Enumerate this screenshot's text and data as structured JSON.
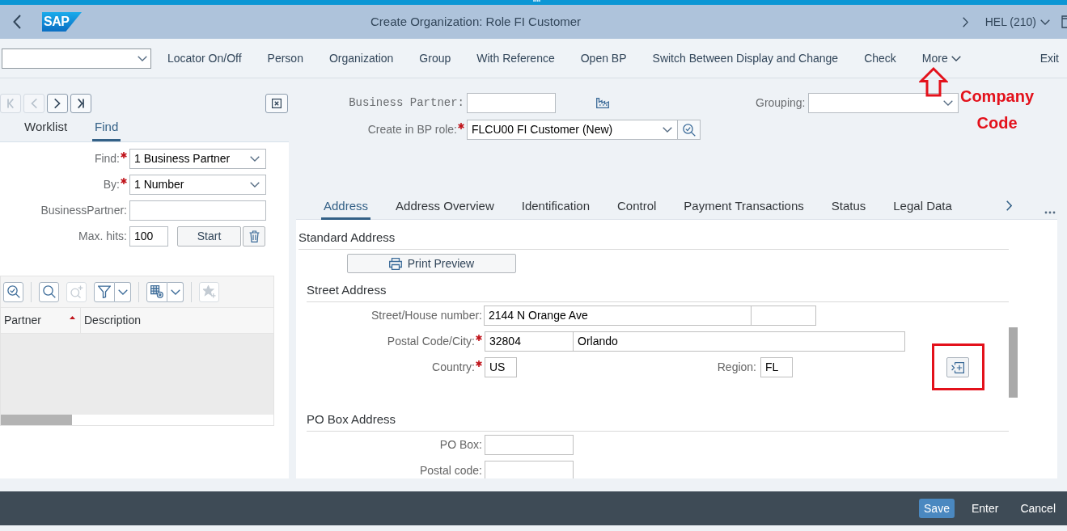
{
  "shell": {
    "logo": "SAP",
    "title": "Create Organization: Role FI Customer",
    "system": "HEL (210)"
  },
  "toolbar": {
    "items": [
      {
        "label": "Locator On/Off",
        "kind": "button"
      },
      {
        "label": "Person",
        "kind": "button"
      },
      {
        "label": "Organization",
        "kind": "button"
      },
      {
        "label": "Group",
        "kind": "button"
      },
      {
        "label": "With Reference",
        "kind": "button"
      },
      {
        "label": "Open BP",
        "kind": "button"
      },
      {
        "label": "Switch Between Display and Change",
        "kind": "button"
      },
      {
        "label": "Check",
        "kind": "button"
      },
      {
        "label": "More",
        "kind": "menu"
      }
    ],
    "exit": "Exit"
  },
  "side_panel": {
    "nav_buttons": [
      {
        "disabled": true
      },
      {
        "disabled": true
      },
      {
        "disabled": false
      },
      {
        "disabled": false
      }
    ],
    "tabs": [
      {
        "label": "Worklist",
        "selected": false
      },
      {
        "label": "Find",
        "selected": true
      }
    ],
    "form": [
      {
        "label": "Find:",
        "required": true,
        "kind": "select",
        "value": "1 Business Partner"
      },
      {
        "label": "By:",
        "required": true,
        "kind": "select",
        "value": "1 Number"
      },
      {
        "label": "BusinessPartner:",
        "required": false,
        "kind": "input"
      },
      {
        "label": "Max. hits:",
        "required": false,
        "kind": "hits",
        "value": "100"
      }
    ],
    "start_button": "Start",
    "tool_buttons": [
      {
        "disabled": false
      },
      {
        "disabled": false
      },
      {
        "disabled": true
      },
      {
        "disabled": false
      },
      {
        "disabled": false
      },
      {
        "disabled": true
      }
    ],
    "table": {
      "columns": [
        {
          "label": "Partner",
          "sorted": true
        },
        {
          "label": "Description",
          "sorted": false
        }
      ]
    }
  },
  "header_fields": {
    "business_partner": {
      "label": "Business Partner:"
    },
    "bp_role": {
      "label": "Create in BP role:",
      "required": true,
      "value": "FLCU00 FI Customer (New)"
    },
    "grouping": {
      "label": "Grouping:"
    }
  },
  "tabs": [
    {
      "label": "Address",
      "selected": true
    },
    {
      "label": "Address Overview",
      "selected": false
    },
    {
      "label": "Identification",
      "selected": false
    },
    {
      "label": "Control",
      "selected": false
    },
    {
      "label": "Payment Transactions",
      "selected": false
    },
    {
      "label": "Status",
      "selected": false
    },
    {
      "label": "Legal Data",
      "selected": false
    }
  ],
  "address": {
    "title": "Standard Address",
    "print_button": "Print Preview",
    "sections": [
      {
        "title": "Street Address",
        "expandable": true,
        "rows": [
          {
            "kind": "street",
            "label": "Street/House number:",
            "required": false,
            "street": "2144 N Orange Ave"
          },
          {
            "kind": "postal_city",
            "label": "Postal Code/City:",
            "required": true,
            "postal_code": "32804",
            "city": "Orlando"
          },
          {
            "kind": "country_region",
            "label": "Country:",
            "required": true,
            "country": "US",
            "region_label": "Region:",
            "region": "FL"
          }
        ]
      },
      {
        "title": "PO Box Address",
        "expandable": false,
        "rows": [
          {
            "kind": "short",
            "label": "PO Box:",
            "required": false
          },
          {
            "kind": "short",
            "label": "Postal code:",
            "required": false
          }
        ]
      }
    ]
  },
  "footer": {
    "buttons": [
      {
        "label": "Save",
        "kind": "primary"
      },
      {
        "label": "Enter",
        "kind": "plain"
      },
      {
        "label": "Cancel",
        "kind": "plain"
      }
    ]
  },
  "annotations": [
    {
      "kind": "arrow"
    },
    {
      "kind": "note",
      "text": "Company Code"
    },
    {
      "kind": "frame"
    }
  ]
}
